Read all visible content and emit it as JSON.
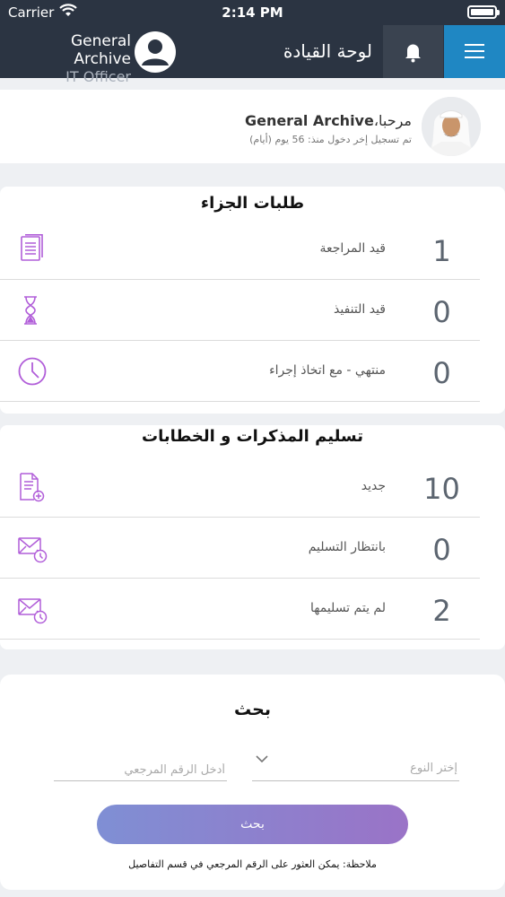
{
  "status_bar": {
    "carrier": "Carrier",
    "time": "2:14 PM"
  },
  "nav": {
    "user_name": "General Archive",
    "user_role": "IT Officer",
    "title": "لوحة القيادة",
    "icons": {
      "avatar": "user-circle-icon",
      "bell": "bell-icon",
      "menu": "hamburger-menu-icon"
    },
    "colors": {
      "bar": "#2b3442",
      "menu_button": "#1f87c3"
    }
  },
  "welcome": {
    "greeting": "مرحبا،",
    "name": "General Archive",
    "last_login": "تم تسجيل إخر دخول منذ: 56 يوم (أيام)"
  },
  "penalty_requests": {
    "title": "طلبات الجزاء",
    "rows": [
      {
        "label": "قيد المراجعة",
        "count": "1",
        "icon": "document-list-icon"
      },
      {
        "label": "قيد التنفيذ",
        "count": "0",
        "icon": "hourglass-icon"
      },
      {
        "label": "منتهي - مع اتخاذ إجراء",
        "count": "0",
        "icon": "clock-icon"
      }
    ]
  },
  "memos_delivery": {
    "title": "تسليم المذكرات و الخطابات",
    "rows": [
      {
        "label": "جديد",
        "count": "10",
        "icon": "new-document-icon"
      },
      {
        "label": "بانتظار التسليم",
        "count": "0",
        "icon": "mail-clock-icon"
      },
      {
        "label": "لم يتم تسليمها",
        "count": "2",
        "icon": "mail-clock-icon"
      }
    ]
  },
  "icon_color": "#b15ed9",
  "search": {
    "title": "بحث",
    "type_placeholder": "إختر النوع",
    "ref_placeholder": "أدخل الرقم المرجعي",
    "button_label": "بحث",
    "note": "ملاحظة: يمكن العثور على الرقم المرجعي في قسم التفاصيل"
  }
}
